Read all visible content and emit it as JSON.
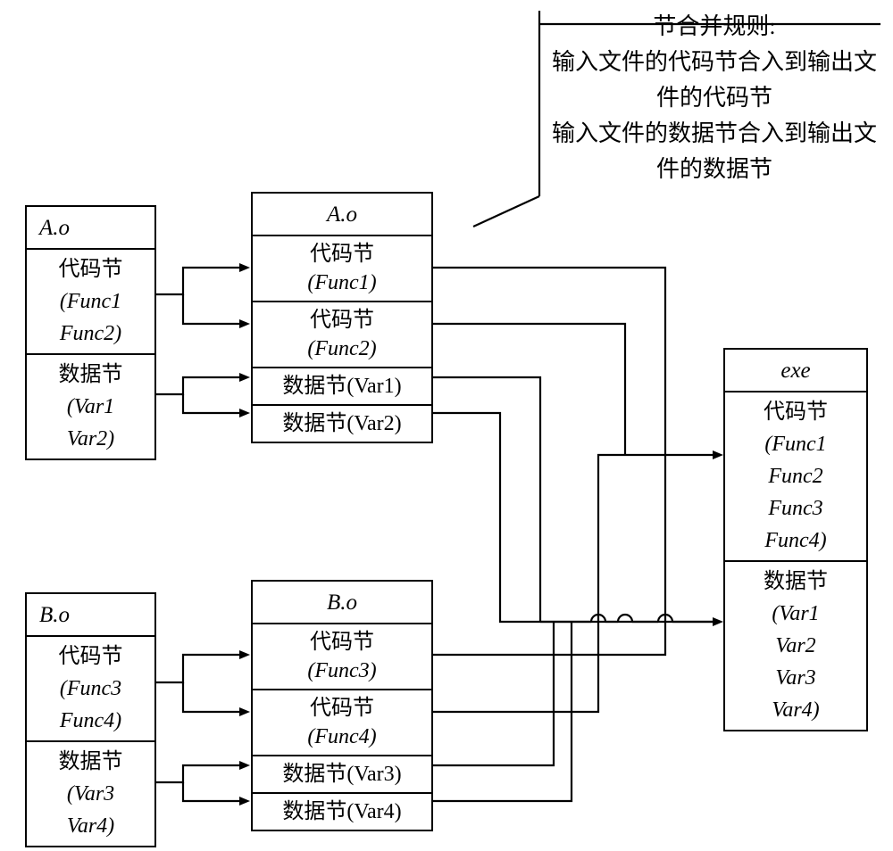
{
  "note": {
    "l1": "节合并规则:",
    "l2": "输入文件的代码节合入到输出文",
    "l3": "件的代码节",
    "l4": "输入文件的数据节合入到输出文",
    "l5": "件的数据节"
  },
  "ao1": {
    "title": "A.o",
    "code_hz": "代码节",
    "code_v": "(Func1\nFunc2)",
    "data_hz": "数据节",
    "data_v": "(Var1\nVar2)"
  },
  "bo1": {
    "title": "B.o",
    "code_hz": "代码节",
    "code_v": "(Func3\nFunc4)",
    "data_hz": "数据节",
    "data_v": "(Var3\nVar4)"
  },
  "ao2": {
    "title": "A.o",
    "c1_hz": "代码节",
    "c1_v": "(Func1)",
    "c2_hz": "代码节",
    "c2_v": "(Func2)",
    "d1": "数据节(Var1)",
    "d2": "数据节(Var2)"
  },
  "bo2": {
    "title": "B.o",
    "c1_hz": "代码节",
    "c1_v": "(Func3)",
    "c2_hz": "代码节",
    "c2_v": "(Func4)",
    "d1": "数据节(Var3)",
    "d2": "数据节(Var4)"
  },
  "exe": {
    "title": "exe",
    "code_hz": "代码节",
    "code_v": "(Func1\nFunc2\nFunc3\nFunc4)",
    "data_hz": "数据节",
    "data_v": "(Var1\nVar2\nVar3\nVar4)"
  }
}
